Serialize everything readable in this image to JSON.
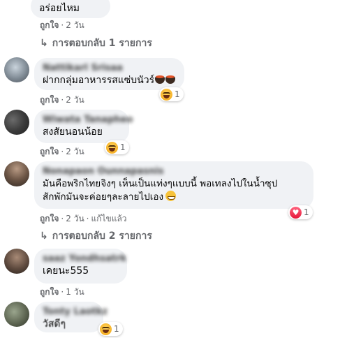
{
  "comments": [
    {
      "text": "อร่อยไหม",
      "like_label": "ถูกใจ",
      "time": "2 วัน",
      "replies": "การตอบกลับ 1 รายการ"
    },
    {
      "author": "Nattikarl Srisaa",
      "text": "ฝากกลุ่มอาหารรสแซ่บนัวร์",
      "like_label": "ถูกใจ",
      "time": "2 วัน",
      "reaction": {
        "icon": "haha-reaction-icon",
        "count": "1"
      }
    },
    {
      "author": "Wiwata Tanapheo",
      "text": "สงสัยนอนน้อย",
      "like_label": "ถูกใจ",
      "time": "2 วัน",
      "reaction": {
        "icon": "haha-reaction-icon",
        "count": "1"
      }
    },
    {
      "author": "Nonapaon Ounnapasnis",
      "text_line1": "มันคือพริกไทยจิงๆ เห็นเป็นแท่งๆแบบนี้ พอเทลงไปในน้ำซุป",
      "text_line2": "สักพักมันจะค่อยๆละลายไปเอง",
      "like_label": "ถูกใจ",
      "time": "2 วัน",
      "edited": "แก้ไขแล้ว",
      "reaction": {
        "icon": "love-reaction-icon",
        "count": "1"
      },
      "replies": "การตอบกลับ 2 รายการ"
    },
    {
      "author": "saaz Yondhsatrk",
      "text": "เคยนะ555",
      "like_label": "ถูกใจ",
      "time": "1 วัน"
    },
    {
      "author": "Tonty Laotkz",
      "text": "วัสดีๆ",
      "like_label": "ถูกใจ",
      "time": "1 วัน",
      "reaction": {
        "icon": "haha-reaction-icon",
        "count": "1"
      }
    }
  ],
  "colors": {
    "bubble": "#f0f2f5",
    "meta": "#65676b",
    "text": "#050505"
  }
}
